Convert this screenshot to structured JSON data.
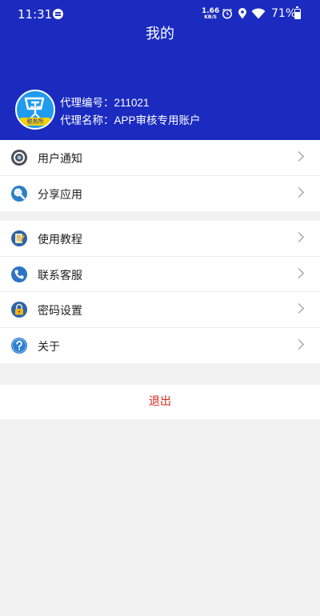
{
  "status_bar": {
    "time": "11:31",
    "speed_value": "1.66",
    "speed_unit": "KB/S",
    "battery_percent": "71%"
  },
  "header": {
    "title": "我的",
    "background_color": "#1b2bc0"
  },
  "profile": {
    "avatar_tag": "税务所",
    "agent_id": "代理编号：211021",
    "agent_name": "代理名称：APP审核专用账户"
  },
  "menu_group_1": [
    {
      "label": "用户通知",
      "icon": "notification-icon"
    },
    {
      "label": "分享应用",
      "icon": "share-icon"
    }
  ],
  "menu_group_2": [
    {
      "label": "使用教程",
      "icon": "tutorial-icon"
    },
    {
      "label": "联系客服",
      "icon": "phone-icon"
    },
    {
      "label": "密码设置",
      "icon": "lock-icon"
    },
    {
      "label": "关于",
      "icon": "help-icon"
    }
  ],
  "logout": {
    "label": "退出",
    "color": "#d4271d"
  }
}
